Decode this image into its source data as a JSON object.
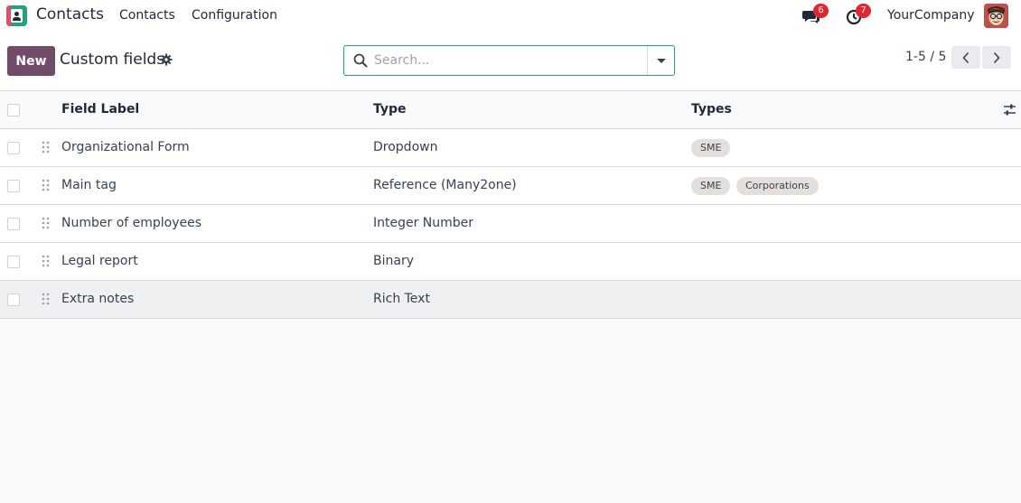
{
  "navbar": {
    "app_name": "Contacts",
    "menus": [
      "Contacts",
      "Configuration"
    ],
    "messages_badge": "6",
    "activities_badge": "7",
    "company": "YourCompany"
  },
  "control_panel": {
    "new_label": "New",
    "title": "Custom fields",
    "search_placeholder": "Search...",
    "pager": "1-5 / 5"
  },
  "table": {
    "columns": [
      "Field Label",
      "Type",
      "Types"
    ],
    "rows": [
      {
        "label": "Organizational Form",
        "type": "Dropdown",
        "tags": [
          "SME"
        ]
      },
      {
        "label": "Main tag",
        "type": "Reference (Many2one)",
        "tags": [
          "SME",
          "Corporations"
        ]
      },
      {
        "label": "Number of employees",
        "type": "Integer Number",
        "tags": []
      },
      {
        "label": "Legal report",
        "type": "Binary",
        "tags": []
      },
      {
        "label": "Extra notes",
        "type": "Rich Text",
        "tags": []
      }
    ]
  },
  "colors": {
    "primary": "#714b67",
    "accent": "#1fa37b",
    "badge": "#e0272f"
  }
}
